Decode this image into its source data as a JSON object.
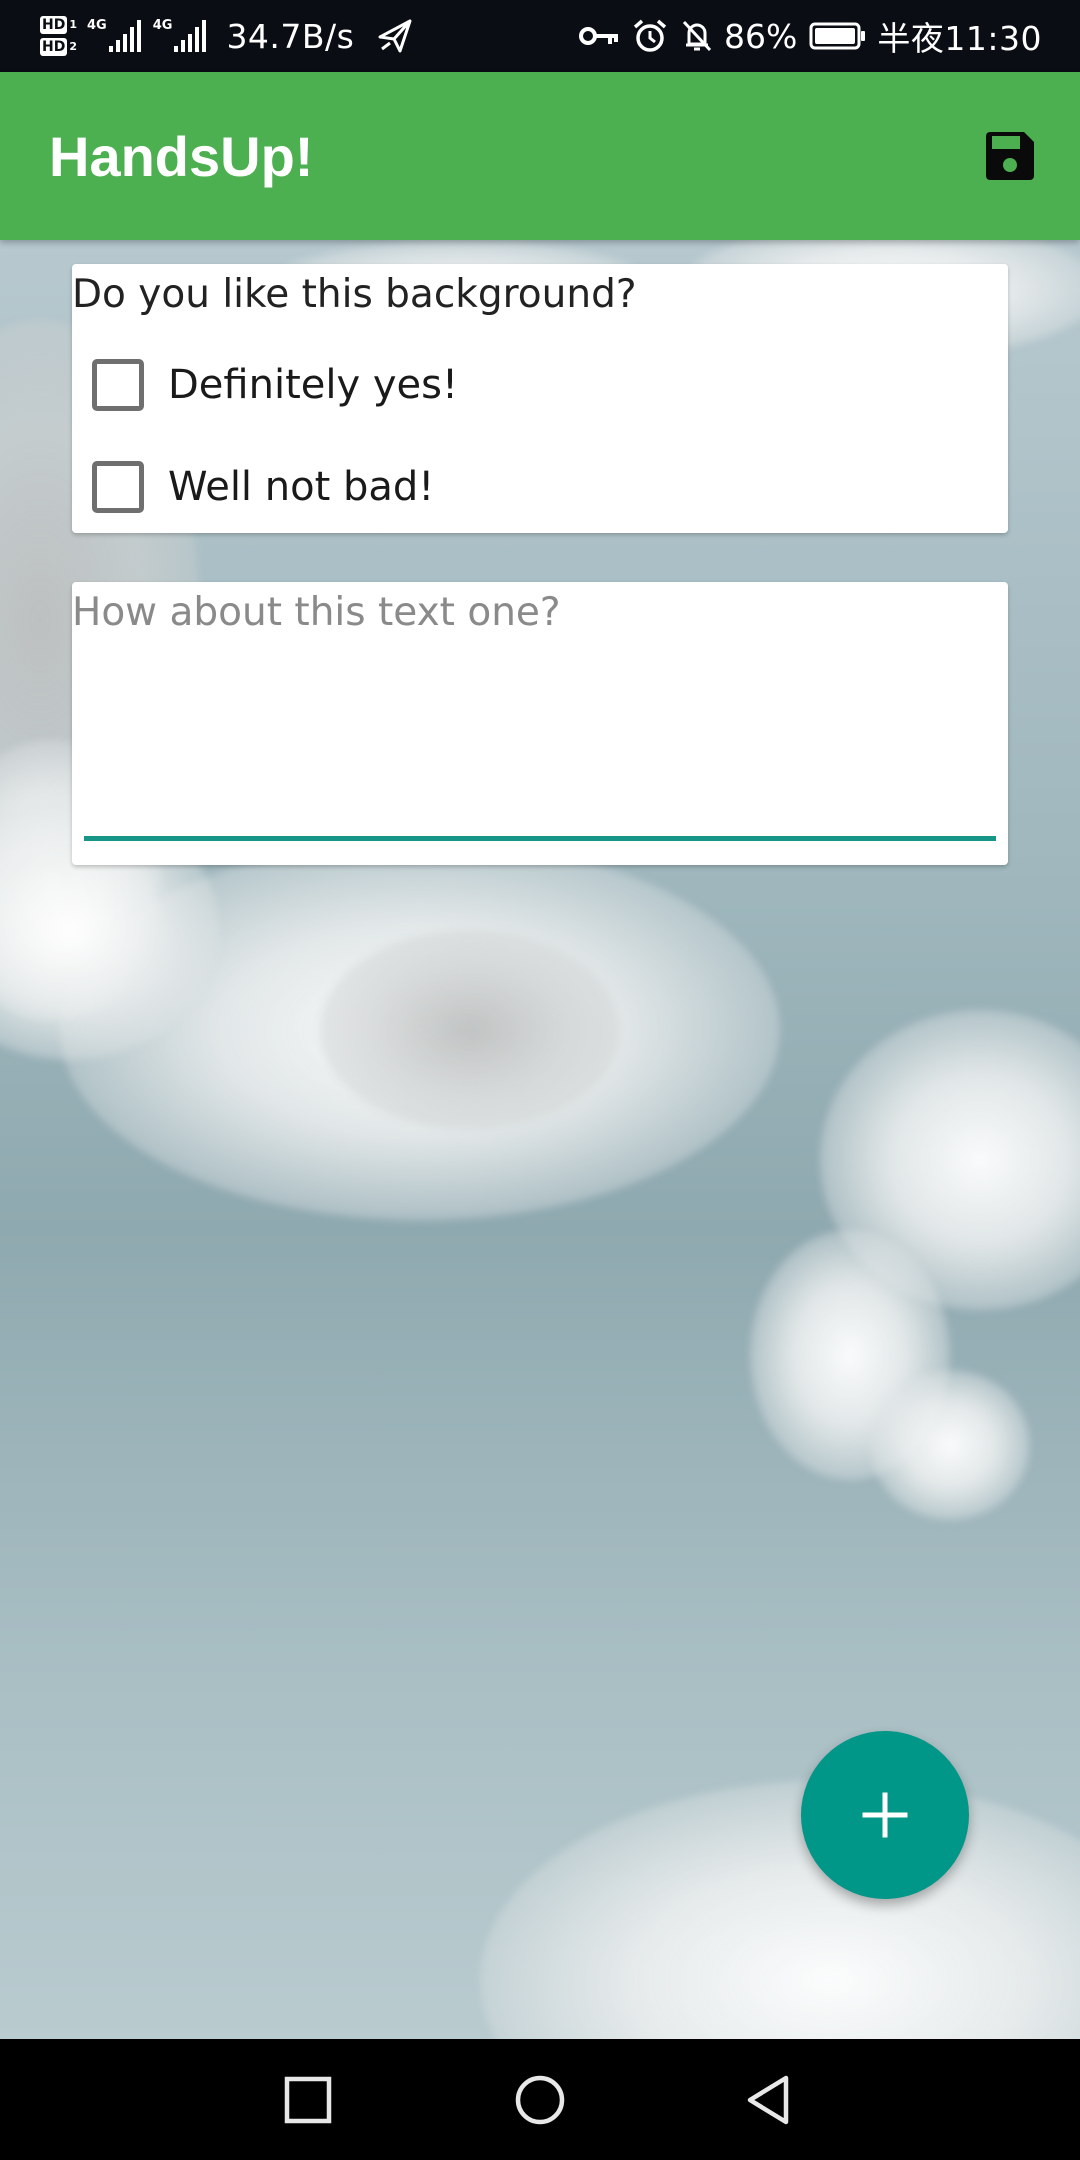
{
  "status_bar": {
    "hd_labels": [
      "HD",
      "HD"
    ],
    "sim_numbers": [
      "1",
      "2"
    ],
    "network_labels": [
      "4G",
      "4G"
    ],
    "net_speed": "34.7B/s",
    "battery_percent": "86%",
    "time": "半夜11:30",
    "icons": [
      "signal-icon",
      "airplane-send-icon",
      "key-icon",
      "alarm-icon",
      "mute-icon",
      "battery-icon"
    ]
  },
  "app_bar": {
    "title": "HandsUp!",
    "action_icon": "save-icon"
  },
  "question_card": {
    "question": "Do you like this background?",
    "options": [
      {
        "label": "Definitely yes!",
        "checked": false
      },
      {
        "label": "Well not bad!",
        "checked": false
      }
    ]
  },
  "text_card": {
    "placeholder": "How about this text one?",
    "value": ""
  },
  "fab": {
    "icon": "plus-icon",
    "color": "#009688"
  },
  "nav_bar": {
    "icons": [
      "recent-apps-icon",
      "home-icon",
      "back-icon"
    ]
  },
  "colors": {
    "app_bar": "#4caf50",
    "accent": "#009688",
    "underline": "#179688"
  }
}
